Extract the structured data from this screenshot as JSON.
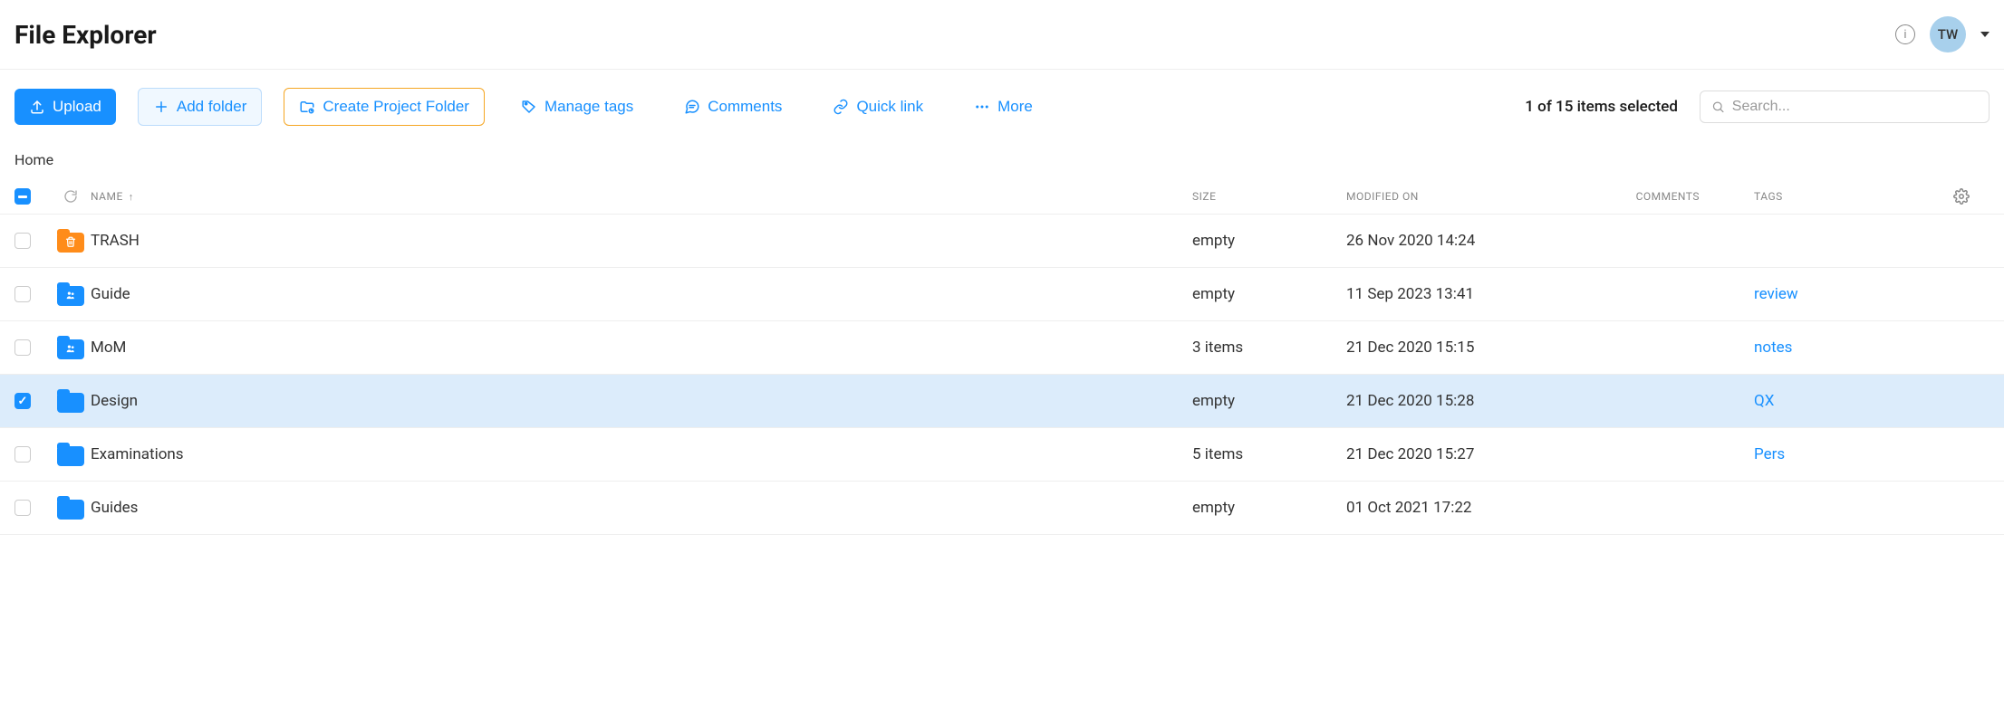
{
  "header": {
    "title": "File Explorer",
    "avatar_initials": "TW"
  },
  "toolbar": {
    "upload_label": "Upload",
    "add_folder_label": "Add folder",
    "create_project_label": "Create Project Folder",
    "manage_tags_label": "Manage tags",
    "comments_label": "Comments",
    "quick_link_label": "Quick link",
    "more_label": "More",
    "selected_text": "1 of 15 items selected",
    "search_placeholder": "Search..."
  },
  "breadcrumb": "Home",
  "columns": {
    "name": "NAME",
    "size": "SIZE",
    "modified": "MODIFIED ON",
    "comments": "COMMENTS",
    "tags": "TAGS"
  },
  "rows": [
    {
      "name": "TRASH",
      "size": "empty",
      "modified": "26 Nov 2020 14:24",
      "tags": "",
      "icon": "trash",
      "selected": false
    },
    {
      "name": "Guide",
      "size": "empty",
      "modified": "11 Sep 2023 13:41",
      "tags": "review",
      "icon": "people",
      "selected": false
    },
    {
      "name": "MoM",
      "size": "3 items",
      "modified": "21 Dec 2020 15:15",
      "tags": "notes",
      "icon": "people",
      "selected": false
    },
    {
      "name": "Design",
      "size": "empty",
      "modified": "21 Dec 2020 15:28",
      "tags": "QX",
      "icon": "folder",
      "selected": true
    },
    {
      "name": "Examinations",
      "size": "5 items",
      "modified": "21 Dec 2020 15:27",
      "tags": "Pers",
      "icon": "folder",
      "selected": false
    },
    {
      "name": "Guides",
      "size": "empty",
      "modified": "01 Oct 2021 17:22",
      "tags": "",
      "icon": "folder",
      "selected": false
    }
  ]
}
